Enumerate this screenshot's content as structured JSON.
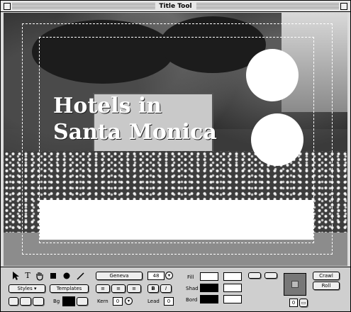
{
  "window": {
    "title": "Title Tool"
  },
  "canvas": {
    "headline_line1": "Hotels in",
    "headline_line2": "Santa Monica"
  },
  "toolbar": {
    "styles_label": "Styles",
    "templates_label": "Templates",
    "font_name": "Geneva",
    "font_size": "48",
    "bg_label": "Bg",
    "kern_label": "Kern",
    "kern_value": "0",
    "lead_label": "Lead",
    "lead_value": "0",
    "fill_label": "Fill",
    "shad_label": "Shad",
    "bord_label": "Bord",
    "crawl_label": "Crawl",
    "roll_label": "Roll",
    "page_value": "0",
    "italic_label": "I",
    "text_tool_glyph": "T"
  },
  "colors": {
    "fill_swatch": "#ffffff",
    "shad_swatch": "#000000",
    "bord_swatch": "#000000",
    "bg_swatch": "#000000"
  },
  "icons": [
    "arrow-tool-icon",
    "text-tool-icon",
    "hand-tool-icon",
    "rectangle-tool-icon",
    "oval-tool-icon",
    "line-tool-icon"
  ]
}
